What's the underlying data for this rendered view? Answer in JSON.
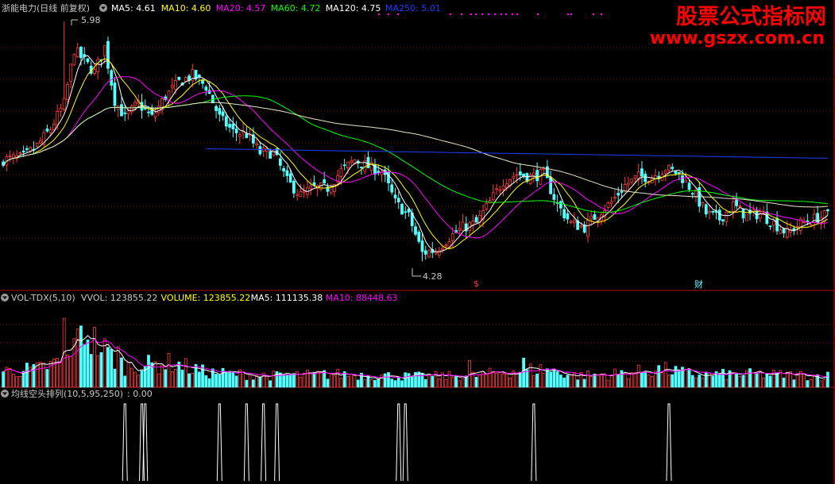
{
  "colors": {
    "up": "#ff3c3c",
    "down": "#54ffff",
    "grid": "#8a1010",
    "ma5": "#ffffff",
    "ma10": "#ffff00",
    "ma20": "#ff00ff",
    "ma60": "#00ff00",
    "ma120": "#ffffff",
    "ma250": "#1e3cff",
    "label_gray": "#c8c8c8",
    "watermark": "#ff0000"
  },
  "price_panel": {
    "title": "浙能电力(日线 前复权)",
    "indicators": [
      {
        "text": "MA5: 4.61",
        "color": "#ffffff"
      },
      {
        "text": "MA10: 4.60",
        "color": "#ffff00"
      },
      {
        "text": "MA20: 4.57",
        "color": "#ff00ff"
      },
      {
        "text": "MA60: 4.72",
        "color": "#00ff00"
      },
      {
        "text": "MA120: 4.75",
        "color": "#ffffff"
      },
      {
        "text": "MA250: 5.01",
        "color": "#1e3cff"
      }
    ],
    "high_label": "5.98",
    "low_label": "4.28",
    "event_markers": [
      "$",
      "财"
    ]
  },
  "volume_panel": {
    "title": "VOL-TDX(5,10)",
    "indicators": [
      {
        "text": "VVOL: 123855.22",
        "color": "#c8c8c8"
      },
      {
        "text": "VOLUME: 123855.22",
        "color": "#ffff00"
      },
      {
        "text": "MA5: 111135.38",
        "color": "#ffffff"
      },
      {
        "text": "MA10: 88448.63",
        "color": "#ff00ff"
      }
    ]
  },
  "signal_panel": {
    "title": "均线空头排列(10,5,95,250)",
    "value": ": 0.00"
  },
  "watermark": {
    "line1": "股票公式指标网",
    "line2": "www.gszx.com.cn"
  },
  "chart_data": {
    "type": "candlestick",
    "price_range": [
      4.28,
      5.98
    ],
    "annotations": [
      {
        "text": "5.98",
        "meaning": "period high"
      },
      {
        "text": "4.28",
        "meaning": "period low"
      }
    ],
    "ma_latest": {
      "MA5": 4.61,
      "MA10": 4.6,
      "MA20": 4.57,
      "MA60": 4.72,
      "MA120": 4.75,
      "MA250": 5.01
    },
    "close_keyframes": [
      [
        0,
        5.0
      ],
      [
        6,
        5.02
      ],
      [
        10,
        5.1
      ],
      [
        14,
        5.22
      ],
      [
        18,
        5.4
      ],
      [
        21,
        5.78
      ],
      [
        24,
        5.7
      ],
      [
        27,
        5.62
      ],
      [
        30,
        5.8
      ],
      [
        33,
        5.42
      ],
      [
        36,
        5.3
      ],
      [
        40,
        5.4
      ],
      [
        44,
        5.3
      ],
      [
        48,
        5.45
      ],
      [
        52,
        5.55
      ],
      [
        56,
        5.6
      ],
      [
        60,
        5.52
      ],
      [
        64,
        5.3
      ],
      [
        68,
        5.2
      ],
      [
        72,
        5.18
      ],
      [
        76,
        5.05
      ],
      [
        80,
        5.05
      ],
      [
        84,
        4.85
      ],
      [
        88,
        4.75
      ],
      [
        92,
        4.8
      ],
      [
        96,
        4.8
      ],
      [
        100,
        4.92
      ],
      [
        104,
        5.0
      ],
      [
        108,
        4.95
      ],
      [
        112,
        4.92
      ],
      [
        116,
        4.7
      ],
      [
        120,
        4.6
      ],
      [
        124,
        4.34
      ],
      [
        128,
        4.36
      ],
      [
        132,
        4.45
      ],
      [
        136,
        4.52
      ],
      [
        140,
        4.55
      ],
      [
        144,
        4.7
      ],
      [
        148,
        4.85
      ],
      [
        152,
        4.9
      ],
      [
        156,
        4.88
      ],
      [
        160,
        4.9
      ],
      [
        164,
        4.68
      ],
      [
        168,
        4.55
      ],
      [
        172,
        4.52
      ],
      [
        176,
        4.62
      ],
      [
        180,
        4.7
      ],
      [
        184,
        4.82
      ],
      [
        188,
        4.88
      ],
      [
        192,
        4.88
      ],
      [
        196,
        4.94
      ],
      [
        200,
        4.9
      ],
      [
        204,
        4.78
      ],
      [
        208,
        4.62
      ],
      [
        212,
        4.58
      ],
      [
        216,
        4.68
      ],
      [
        220,
        4.6
      ],
      [
        224,
        4.62
      ],
      [
        228,
        4.55
      ],
      [
        232,
        4.48
      ],
      [
        236,
        4.55
      ],
      [
        240,
        4.58
      ],
      [
        244,
        4.61
      ]
    ],
    "bar_count": 245,
    "volume_keyframes": [
      [
        0,
        0.2
      ],
      [
        10,
        0.22
      ],
      [
        20,
        0.35
      ],
      [
        24,
        0.72
      ],
      [
        26,
        0.6
      ],
      [
        30,
        0.45
      ],
      [
        36,
        0.25
      ],
      [
        50,
        0.3
      ],
      [
        60,
        0.18
      ],
      [
        80,
        0.14
      ],
      [
        100,
        0.16
      ],
      [
        120,
        0.13
      ],
      [
        140,
        0.14
      ],
      [
        150,
        0.2
      ],
      [
        160,
        0.22
      ],
      [
        170,
        0.14
      ],
      [
        180,
        0.16
      ],
      [
        195,
        0.22
      ],
      [
        205,
        0.15
      ],
      [
        220,
        0.16
      ],
      [
        244,
        0.14
      ]
    ],
    "volume_spikes": [
      {
        "bar": 18,
        "value": 0.85
      },
      {
        "bar": 21,
        "value": 0.6
      },
      {
        "bar": 154,
        "value": 0.36
      },
      {
        "bar": 138,
        "value": 0.33
      },
      {
        "bar": 34,
        "value": 0.5
      }
    ],
    "signal_pulses_bar": [
      36,
      41,
      42,
      64,
      72,
      77,
      81,
      117,
      119,
      157,
      197
    ],
    "signal_value": 0.0
  }
}
